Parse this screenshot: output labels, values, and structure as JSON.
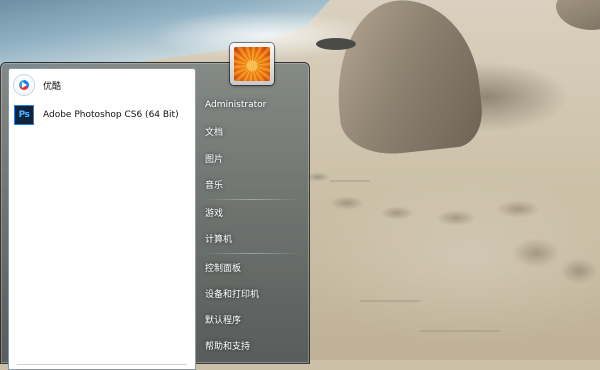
{
  "desktop": {
    "wallpaper": "beach-with-rocks-and-footprints"
  },
  "start_menu": {
    "user": {
      "picture_icon": "orange-flower-user-picture"
    },
    "pinned_programs": [
      {
        "label": "优酷",
        "icon": "youku-icon"
      },
      {
        "label": "Adobe Photoshop CS6 (64 Bit)",
        "icon": "photoshop-icon"
      }
    ],
    "right_pane": {
      "user_name": "Administrator",
      "items": [
        {
          "label": "文档"
        },
        {
          "label": "图片"
        },
        {
          "label": "音乐"
        },
        {
          "label": "游戏"
        },
        {
          "label": "计算机"
        },
        {
          "label": "控制面板"
        },
        {
          "label": "设备和打印机"
        },
        {
          "label": "默认程序"
        },
        {
          "label": "帮助和支持"
        }
      ]
    }
  }
}
